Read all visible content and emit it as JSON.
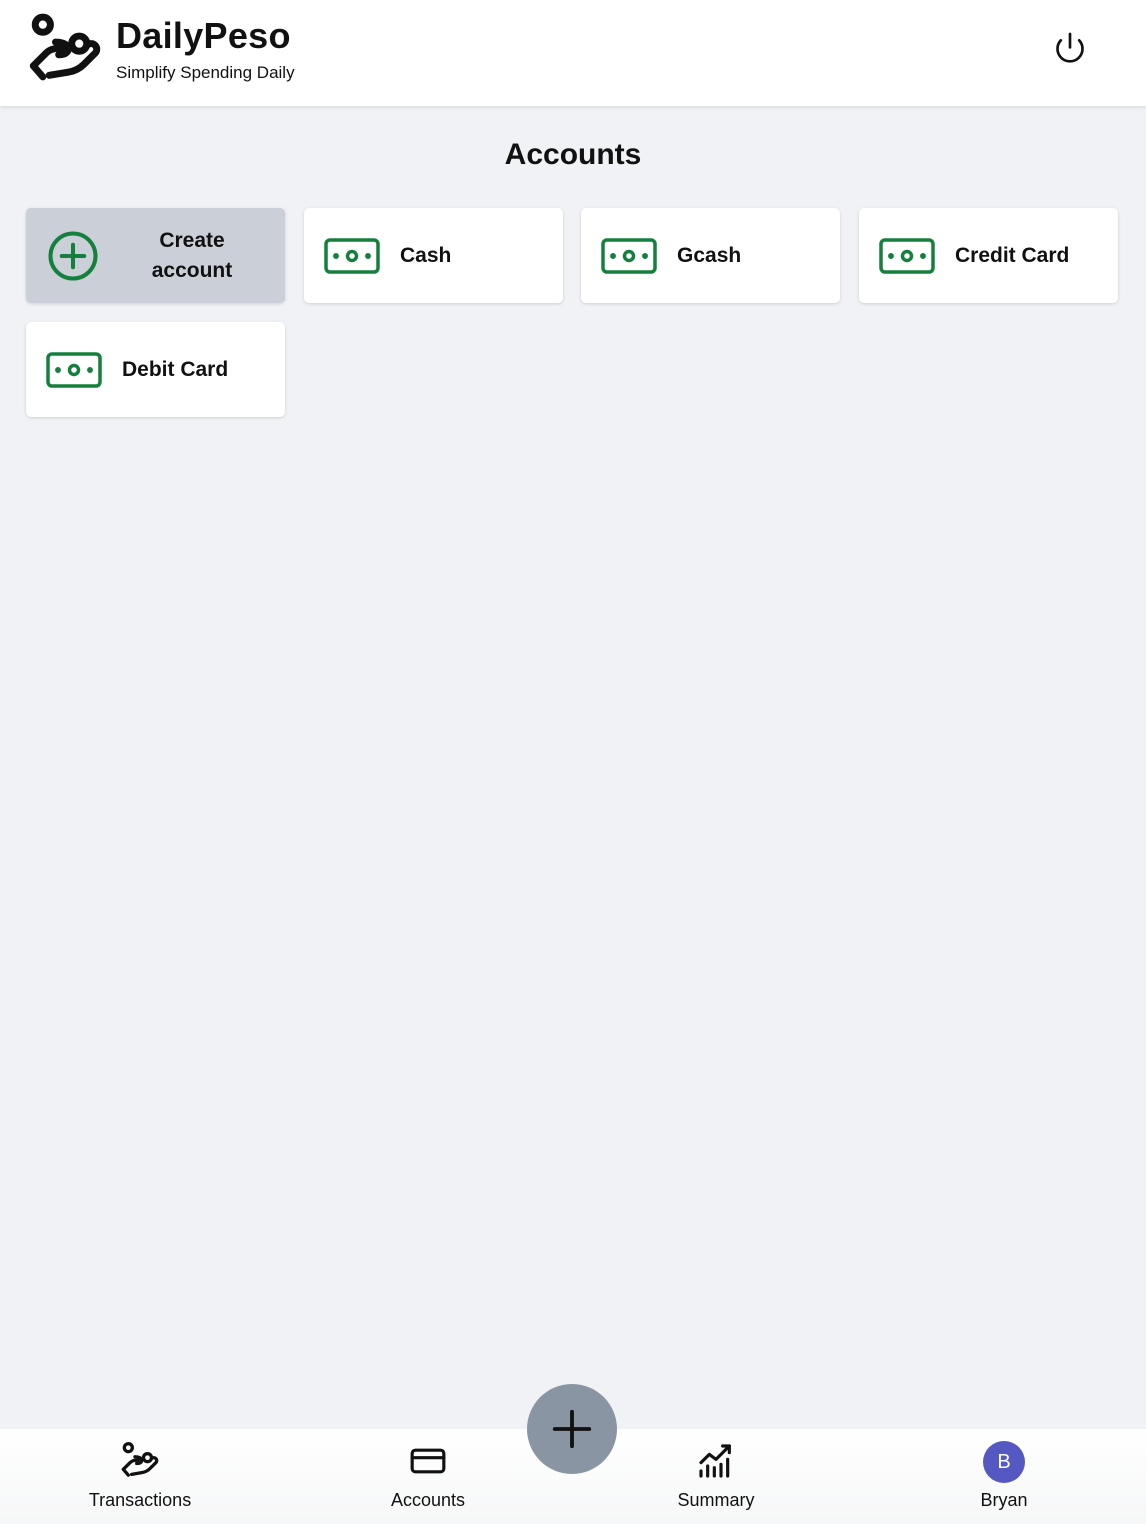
{
  "app": {
    "name": "DailyPeso",
    "tagline": "Simplify Spending Daily"
  },
  "header": {
    "logo_icon": "hand-coins-icon",
    "power_icon": "power-icon"
  },
  "main": {
    "title": "Accounts",
    "create_card": {
      "label": "Create account",
      "icon": "plus-circle-icon"
    },
    "accounts": [
      {
        "label": "Cash",
        "icon": "banknote-icon"
      },
      {
        "label": "Gcash",
        "icon": "banknote-icon"
      },
      {
        "label": "Credit Card",
        "icon": "banknote-icon"
      },
      {
        "label": "Debit Card",
        "icon": "banknote-icon"
      }
    ]
  },
  "bottom_nav": {
    "items": [
      {
        "label": "Transactions",
        "icon": "hand-coins-icon"
      },
      {
        "label": "Accounts",
        "icon": "credit-card-icon"
      },
      {
        "label": "Summary",
        "icon": "chart-icon"
      },
      {
        "label": "Bryan",
        "icon": "avatar",
        "avatar_letter": "B"
      }
    ],
    "fab_icon": "plus-icon"
  },
  "colors": {
    "accent_green": "#15803d",
    "avatar_bg": "#5558c0",
    "fab_bg": "#8a95a3",
    "page_bg": "#f0f2f5"
  }
}
